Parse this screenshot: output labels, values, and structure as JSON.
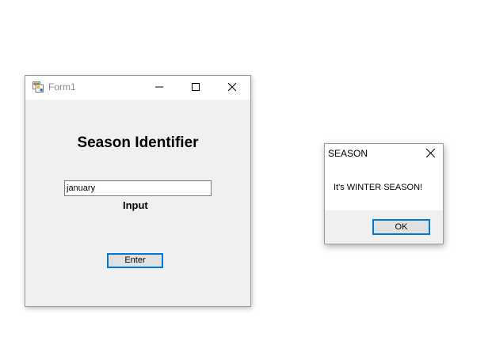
{
  "form": {
    "title": "Form1",
    "heading": "Season Identifier",
    "input_value": "january",
    "input_label": "Input",
    "enter_label": "Enter"
  },
  "message_box": {
    "title": "SEASON",
    "message": "It's WINTER SEASON!",
    "ok_label": "OK"
  },
  "icons": {
    "app": "form-app-icon",
    "minimize": "minimize-icon",
    "maximize": "maximize-icon",
    "close": "close-icon"
  },
  "colors": {
    "accent": "#0078d7",
    "form_background": "#f0f0f0",
    "button_face": "#e1e1e1"
  }
}
